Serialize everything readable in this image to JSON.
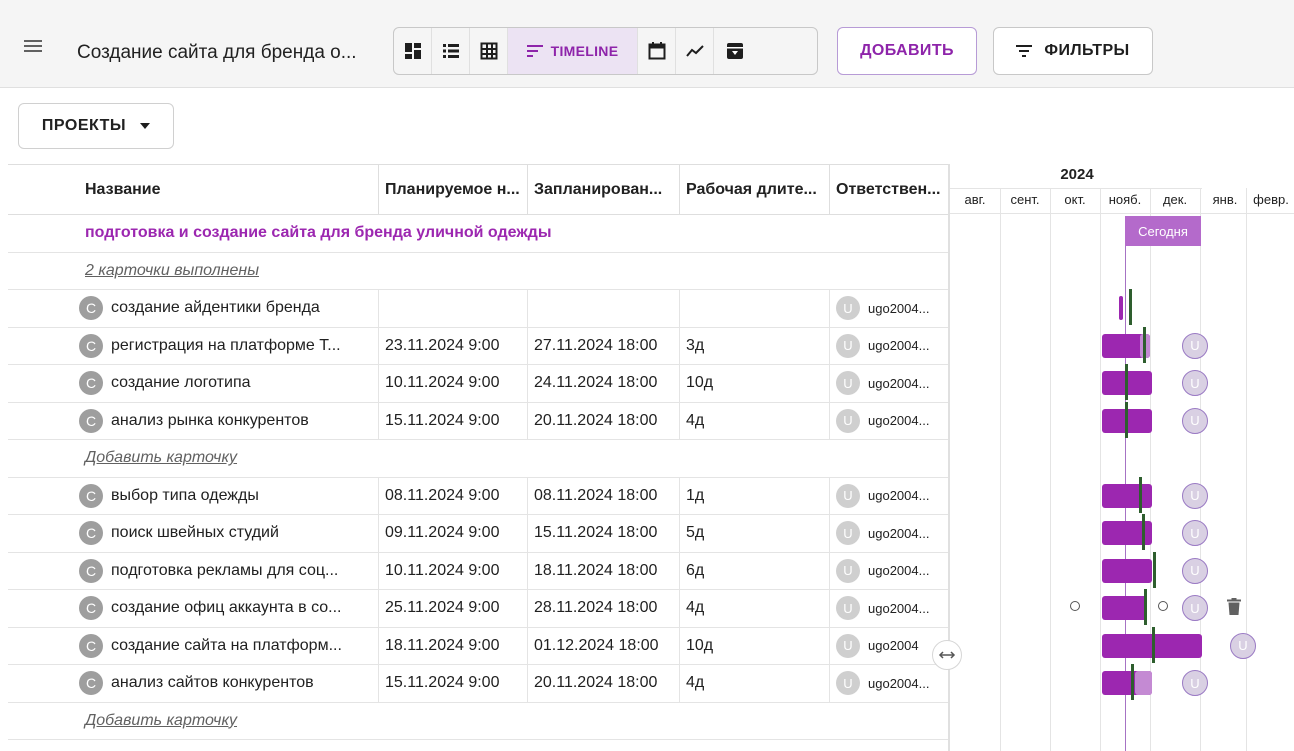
{
  "toolbar": {
    "title": "Создание сайта для бренда о...",
    "views": {
      "timeline_label": "TIMELINE"
    },
    "add_label": "ДОБАВИТЬ",
    "filters_label": "ФИЛЬТРЫ",
    "icons": [
      "menu-icon",
      "dashboard-icon",
      "list-icon",
      "table-icon",
      "timeline-icon",
      "calendar-icon",
      "chart-icon",
      "archive-icon",
      "filter-icon"
    ]
  },
  "projects": {
    "label": "ПРОЕКТЫ"
  },
  "table": {
    "headers": {
      "name": "Название",
      "planned_start": "Планируемое н...",
      "scheduled": "Запланирован...",
      "duration": "Рабочая длите...",
      "responsible": "Ответствен..."
    },
    "group1_title": "подготовка и создание сайта для бренда уличной одежды",
    "done_link": "2 карточки выполнены",
    "add_card_1": "Добавить карточку",
    "add_card_2": "Добавить карточку",
    "tasks_a": [
      {
        "avatar": "C",
        "name": "создание айдентики бренда",
        "start": "",
        "end": "",
        "duration": "",
        "user_initial": "U",
        "user": "ugo2004..."
      },
      {
        "avatar": "C",
        "name": "регистрация на платформе Т...",
        "start": "23.11.2024 9:00",
        "end": "27.11.2024 18:00",
        "duration": "3д",
        "user_initial": "U",
        "user": "ugo2004..."
      },
      {
        "avatar": "C",
        "name": "создание логотипа",
        "start": "10.11.2024 9:00",
        "end": "24.11.2024 18:00",
        "duration": "10д",
        "user_initial": "U",
        "user": "ugo2004..."
      },
      {
        "avatar": "C",
        "name": "анализ рынка конкурентов",
        "start": "15.11.2024 9:00",
        "end": "20.11.2024 18:00",
        "duration": "4д",
        "user_initial": "U",
        "user": "ugo2004..."
      }
    ],
    "tasks_b": [
      {
        "avatar": "C",
        "name": "выбор типа одежды",
        "start": "08.11.2024 9:00",
        "end": "08.11.2024 18:00",
        "duration": "1д",
        "user_initial": "U",
        "user": "ugo2004..."
      },
      {
        "avatar": "C",
        "name": "поиск швейных студий",
        "start": "09.11.2024 9:00",
        "end": "15.11.2024 18:00",
        "duration": "5д",
        "user_initial": "U",
        "user": "ugo2004..."
      },
      {
        "avatar": "C",
        "name": "подготовка рекламы для соц...",
        "start": "10.11.2024 9:00",
        "end": "18.11.2024 18:00",
        "duration": "6д",
        "user_initial": "U",
        "user": "ugo2004..."
      },
      {
        "avatar": "C",
        "name": "создание офиц аккаунта в со...",
        "start": "25.11.2024 9:00",
        "end": "28.11.2024 18:00",
        "duration": "4д",
        "user_initial": "U",
        "user": "ugo2004..."
      },
      {
        "avatar": "C",
        "name": "создание сайта на платформ...",
        "start": "18.11.2024 9:00",
        "end": "01.12.2024 18:00",
        "duration": "10д",
        "user_initial": "U",
        "user": "ugo2004"
      },
      {
        "avatar": "C",
        "name": "анализ сайтов конкурентов",
        "start": "15.11.2024 9:00",
        "end": "20.11.2024 18:00",
        "duration": "4д",
        "user_initial": "U",
        "user": "ugo2004..."
      }
    ]
  },
  "timeline": {
    "year": "2024",
    "months": [
      "авг.",
      "сент.",
      "окт.",
      "нояб.",
      "дек.",
      "янв.",
      "февр."
    ],
    "today_label": "Сегодня",
    "user_initial": "U",
    "colors": {
      "bar": "#9c27b0",
      "bar_light": "#c48ad3",
      "today": "#b46acb",
      "marker": "#2e5e2e"
    }
  }
}
